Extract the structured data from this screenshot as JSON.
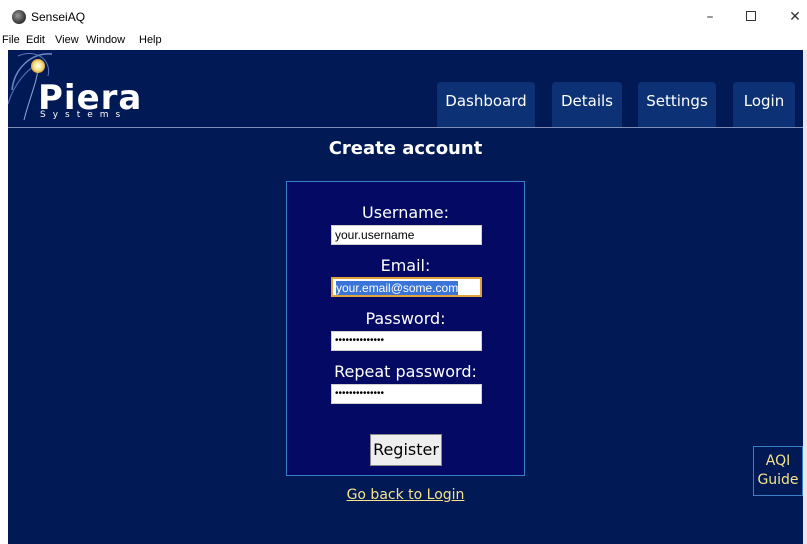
{
  "window": {
    "title": "SenseiAQ",
    "minimize": "–",
    "close": "✕"
  },
  "menu": [
    "File",
    "Edit",
    "View",
    "Window",
    "Help"
  ],
  "logo": {
    "name": "Piera",
    "subtitle": "Systems"
  },
  "nav": {
    "tabs": [
      {
        "label": "Dashboard"
      },
      {
        "label": "Details"
      },
      {
        "label": "Settings"
      },
      {
        "label": "Login"
      }
    ]
  },
  "page": {
    "title": "Create account"
  },
  "form": {
    "username_label": "Username:",
    "username_value": "your.username",
    "email_label": "Email:",
    "email_value": "your.email@some.com",
    "password_label": "Password:",
    "password_value": "••••••••••••••",
    "repeat_label": "Repeat password:",
    "repeat_value": "••••••••••••••",
    "register_label": "Register"
  },
  "links": {
    "back_to_login": "Go back to Login"
  },
  "aqi_guide": {
    "line1": "AQI",
    "line2": "Guide"
  },
  "colors": {
    "app_background": "#011a55",
    "tab_background": "#0c3175",
    "form_background": "#040a63",
    "link_color": "#f4e38a",
    "focus_border": "#e0a33a"
  }
}
